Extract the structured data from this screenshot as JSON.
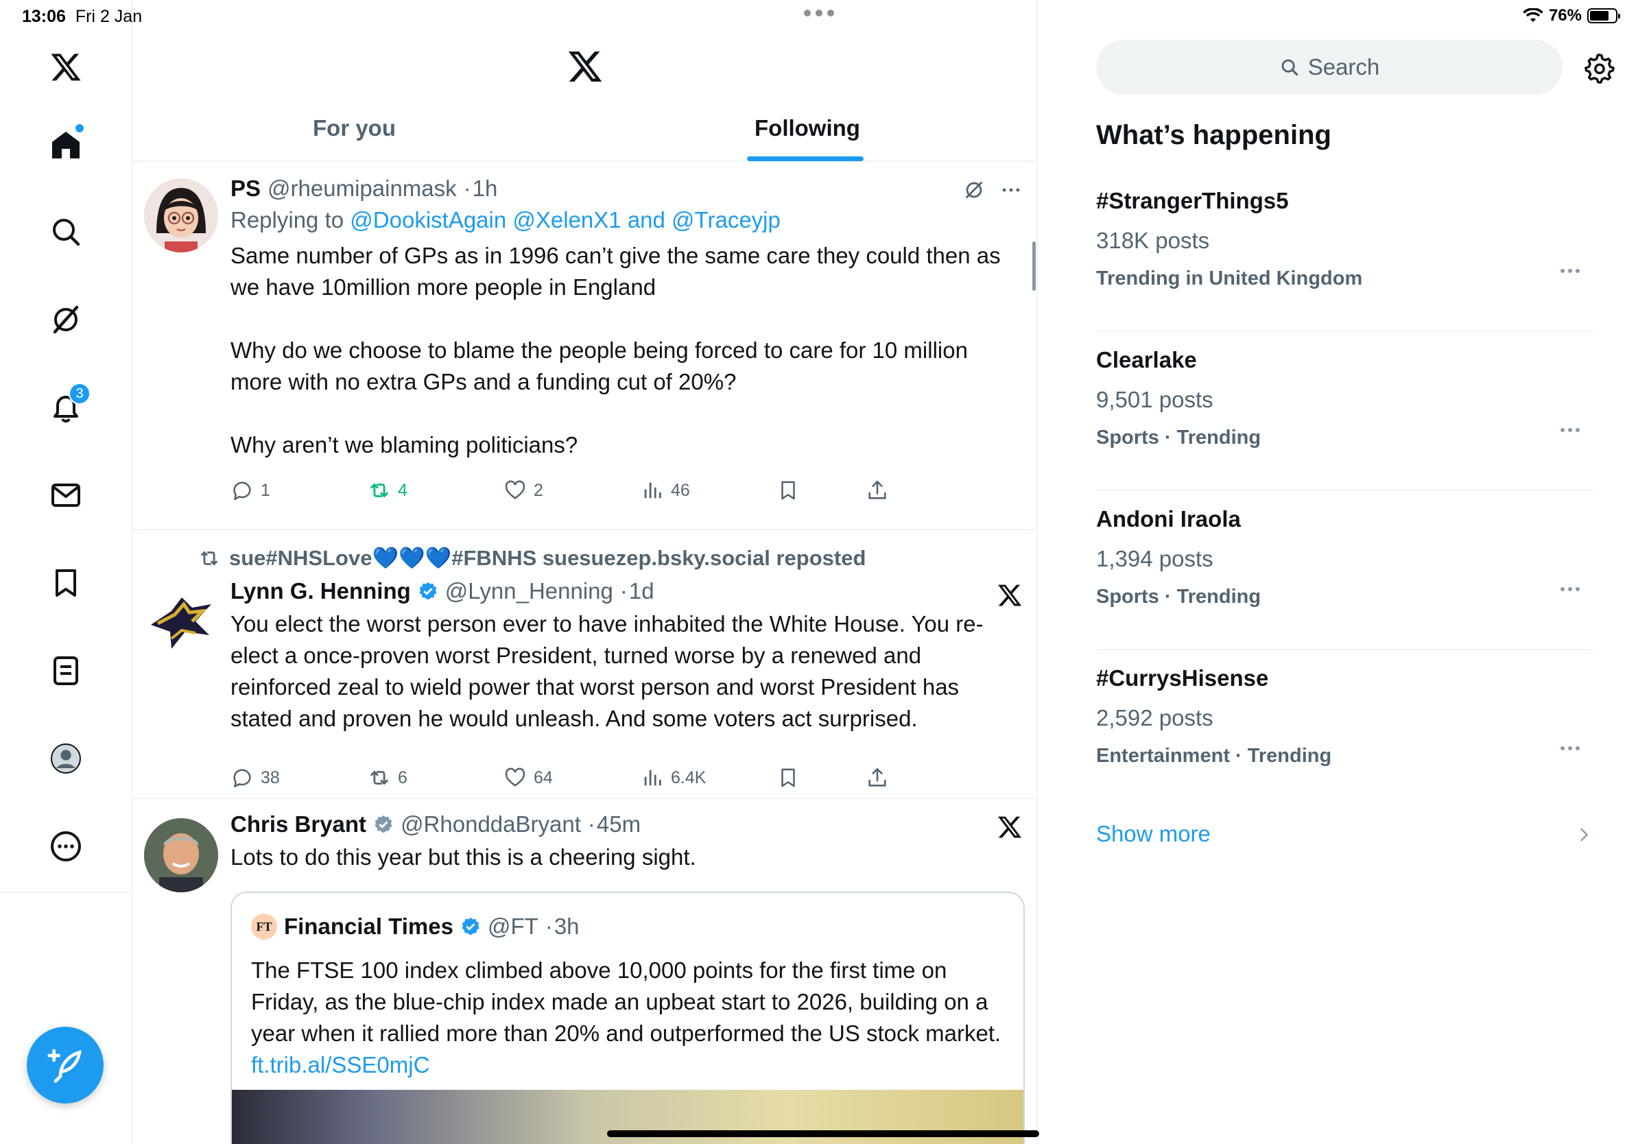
{
  "status": {
    "time": "13:06",
    "date": "Fri 2 Jan",
    "battery": "76%",
    "battery_level": 0.76
  },
  "nav": {
    "notifications_badge": "3"
  },
  "header": {
    "tabs": [
      {
        "label": "For you"
      },
      {
        "label": "Following"
      }
    ],
    "active_tab": "Following"
  },
  "tweets": [
    {
      "name": "PS",
      "handle": "@rheumipainmask",
      "time": "1h",
      "replying_prefix": "Replying to",
      "replying_to": "@DookistAgain @XelenX1 and @Traceyjp",
      "text": "Same number of GPs as in 1996 can’t give the same care they could then as we have 10million more people in England\n\nWhy do we choose to blame the people being forced to care for 10 million more with no extra GPs and a funding cut of 20%?\n\nWhy aren’t we blaming politicians?",
      "replies": "1",
      "reposts": "4",
      "likes": "2",
      "views": "46"
    },
    {
      "repost_by": "sue#NHSLove💙💙💙#FBNHS suesuezep.bsky.social reposted",
      "name": "Lynn G. Henning",
      "handle": "@Lynn_Henning",
      "time": "1d",
      "text": "You elect the worst person ever to have inhabited the White House. You re-elect a once-proven worst President, turned worse by a renewed and reinforced zeal to wield power that worst person and worst President has stated and proven he would unleash. And some voters act surprised.",
      "replies": "38",
      "reposts": "6",
      "likes": "64",
      "views": "6.4K"
    },
    {
      "name": "Chris Bryant",
      "handle": "@RhonddaBryant",
      "time": "45m",
      "text": "Lots to do this year but this is a cheering sight.",
      "quote": {
        "logo": "FT",
        "name": "Financial Times",
        "handle": "@FT",
        "time": "3h",
        "text": "The FTSE 100 index climbed above 10,000 points for the first time on Friday, as the blue-chip index made an upbeat start to 2026, building on a year when it rallied more than 20% and outperformed the US stock market.",
        "link": "ft.trib.al/SSE0mjC"
      }
    }
  ],
  "sidebar_right": {
    "search_placeholder": "Search",
    "title": "What’s happening",
    "trends": [
      {
        "name": "#StrangerThings5",
        "count": "318K posts",
        "context": "Trending in United Kingdom"
      },
      {
        "name": "Clearlake",
        "count": "9,501 posts",
        "context": "Sports · Trending"
      },
      {
        "name": "Andoni Iraola",
        "count": "1,394 posts",
        "context": "Sports · Trending"
      },
      {
        "name": "#CurrysHisense",
        "count": "2,592 posts",
        "context": "Entertainment · Trending"
      }
    ],
    "show_more": "Show more"
  },
  "colors": {
    "accent": "#1d9bf0",
    "repost_green": "#00ba7c",
    "text": "#0f1419",
    "muted": "#536471"
  },
  "icons": [
    "x-logo",
    "home-icon",
    "search-icon",
    "grok-icon",
    "bell-icon",
    "mail-icon",
    "bookmark-icon",
    "list-icon",
    "profile-icon",
    "more-icon",
    "compose-icon",
    "gear-icon"
  ]
}
